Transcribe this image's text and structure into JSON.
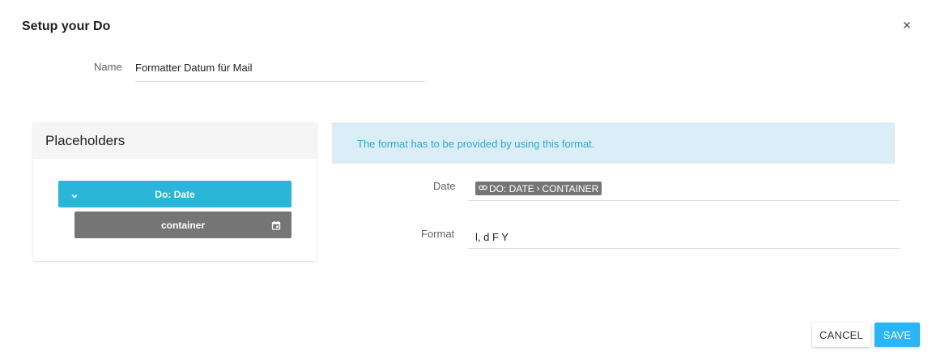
{
  "dialog": {
    "title": "Setup your Do",
    "close_icon": "close-icon"
  },
  "name": {
    "label": "Name",
    "value": "Formatter Datum für Mail"
  },
  "placeholders": {
    "title": "Placeholders",
    "group_label": "Do: Date",
    "group_icon": "chevron-down-icon",
    "item_label": "container",
    "item_icon": "calendar-icon"
  },
  "info": {
    "text": "The format has to be provided by using this format."
  },
  "date": {
    "label": "Date",
    "chip_icon": "link-icon",
    "chip_part1": "DO: DATE",
    "chip_separator": "›",
    "chip_part2": "CONTAINER"
  },
  "format": {
    "label": "Format",
    "value": "l, d F Y"
  },
  "buttons": {
    "cancel": "CANCEL",
    "save": "SAVE"
  },
  "colors": {
    "accent": "#29b6d9",
    "save": "#29b6f6",
    "chip": "#757575",
    "info_bg": "#dbeef7",
    "info_text": "#29a9d2"
  }
}
